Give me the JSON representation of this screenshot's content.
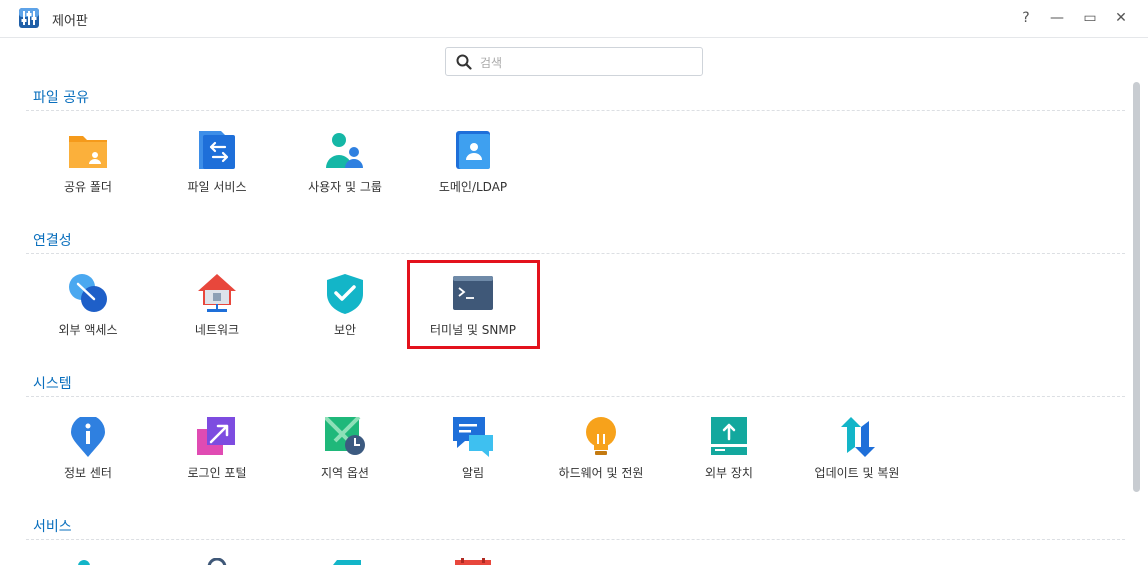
{
  "window": {
    "title": "제어판",
    "controls": {
      "help": "?",
      "minimize": "—",
      "maximize": "▭",
      "close": "✕"
    }
  },
  "search": {
    "placeholder": "검색",
    "value": ""
  },
  "sections": [
    {
      "title": "파일 공유",
      "items": [
        {
          "label": "공유 폴더",
          "icon": "shared-folder-icon"
        },
        {
          "label": "파일 서비스",
          "icon": "file-services-icon"
        },
        {
          "label": "사용자 및 그룹",
          "icon": "users-groups-icon"
        },
        {
          "label": "도메인/LDAP",
          "icon": "domain-ldap-icon"
        }
      ]
    },
    {
      "title": "연결성",
      "items": [
        {
          "label": "외부 액세스",
          "icon": "external-access-icon"
        },
        {
          "label": "네트워크",
          "icon": "network-icon"
        },
        {
          "label": "보안",
          "icon": "security-shield-icon"
        },
        {
          "label": "터미널 및 SNMP",
          "icon": "terminal-icon",
          "highlighted": true
        }
      ]
    },
    {
      "title": "시스템",
      "items": [
        {
          "label": "정보 센터",
          "icon": "info-center-icon"
        },
        {
          "label": "로그인 포털",
          "icon": "login-portal-icon"
        },
        {
          "label": "지역 옵션",
          "icon": "regional-options-icon"
        },
        {
          "label": "알림",
          "icon": "notification-icon"
        },
        {
          "label": "하드웨어 및 전원",
          "icon": "hardware-power-icon"
        },
        {
          "label": "외부 장치",
          "icon": "external-devices-icon"
        },
        {
          "label": "업데이트 및 복원",
          "icon": "update-restore-icon"
        }
      ]
    },
    {
      "title": "서비스",
      "items": []
    }
  ],
  "colors": {
    "accent": "#0a6fbd",
    "highlight_border": "#e3121c"
  }
}
